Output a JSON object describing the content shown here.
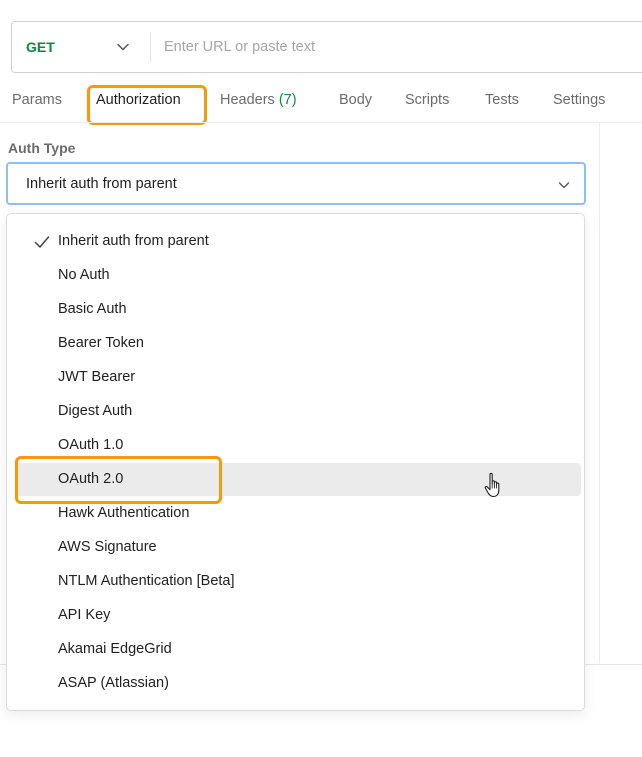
{
  "request": {
    "method": "GET",
    "url_placeholder": "Enter URL or paste text",
    "method_color": "#0b8a3e"
  },
  "tabs": [
    {
      "label": "Params"
    },
    {
      "label": "Authorization",
      "active": true
    },
    {
      "label": "Headers",
      "count": "(7)"
    },
    {
      "label": "Body"
    },
    {
      "label": "Scripts"
    },
    {
      "label": "Tests"
    },
    {
      "label": "Settings"
    }
  ],
  "auth": {
    "label": "Auth Type",
    "selected": "Inherit auth from parent",
    "options": [
      {
        "label": "Inherit auth from parent",
        "checked": true
      },
      {
        "label": "No Auth"
      },
      {
        "label": "Basic Auth"
      },
      {
        "label": "Bearer Token"
      },
      {
        "label": "JWT Bearer"
      },
      {
        "label": "Digest Auth"
      },
      {
        "label": "OAuth 1.0"
      },
      {
        "label": "OAuth 2.0",
        "hovered": true
      },
      {
        "label": "Hawk Authentication"
      },
      {
        "label": "AWS Signature"
      },
      {
        "label": "NTLM Authentication [Beta]"
      },
      {
        "label": "API Key"
      },
      {
        "label": "Akamai EdgeGrid"
      },
      {
        "label": "ASAP (Atlassian)"
      }
    ]
  },
  "colors": {
    "highlight": "#f59a0c",
    "focus_border": "#8fbef0",
    "hover_bg": "#ebebeb"
  },
  "icons": {
    "method_dropdown": "chevron-down-icon",
    "auth_dropdown": "chevron-down-icon",
    "selected_marker": "check-icon",
    "pointer": "hand-cursor-icon"
  }
}
